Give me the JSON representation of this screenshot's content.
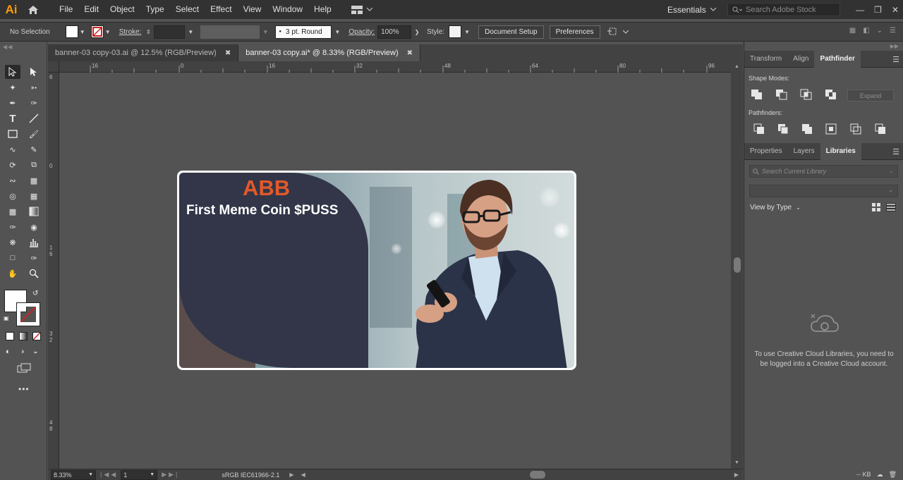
{
  "app": {
    "logo": "Ai",
    "menus": [
      "File",
      "Edit",
      "Object",
      "Type",
      "Select",
      "Effect",
      "View",
      "Window",
      "Help"
    ],
    "workspace": "Essentials",
    "stock_search_placeholder": "Search Adobe Stock"
  },
  "control_bar": {
    "selection": "No Selection",
    "stroke_label": "Stroke:",
    "brush": "3 pt. Round",
    "opacity_label": "Opacity:",
    "opacity_value": "100%",
    "style_label": "Style:",
    "document_setup": "Document Setup",
    "preferences": "Preferences"
  },
  "tabs": [
    {
      "title": "banner-03 copy-03.ai @ 12.5% (RGB/Preview)",
      "active": false
    },
    {
      "title": "banner-03 copy.ai* @ 8.33% (RGB/Preview)",
      "active": true
    }
  ],
  "rulers": {
    "horizontal": [
      "16",
      "0",
      "16",
      "32",
      "48",
      "64",
      "80",
      "96"
    ],
    "vertical": [
      "6",
      "0",
      "1 6",
      "3 2",
      "4 8"
    ]
  },
  "artboard": {
    "title": "ABB",
    "subtitle": "First Meme Coin $PUSS",
    "title_color": "#e2592b",
    "panel_color": "#323648"
  },
  "statusbar": {
    "zoom": "8.33%",
    "page": "1",
    "profile": "sRGB IEC61966-2.1"
  },
  "right_panel": {
    "top_tabs": [
      "Transform",
      "Align",
      "Pathfinder"
    ],
    "shape_modes_label": "Shape Modes:",
    "expand_label": "Expand",
    "pathfinders_label": "Pathfinders:",
    "bottom_tabs": [
      "Properties",
      "Layers",
      "Libraries"
    ],
    "search_library_placeholder": "Search Current Library",
    "view_by": "View by Type",
    "cc_message": "To use Creative Cloud Libraries, you need to be logged into a Creative Cloud account.",
    "footer_kb": "-- KB"
  }
}
